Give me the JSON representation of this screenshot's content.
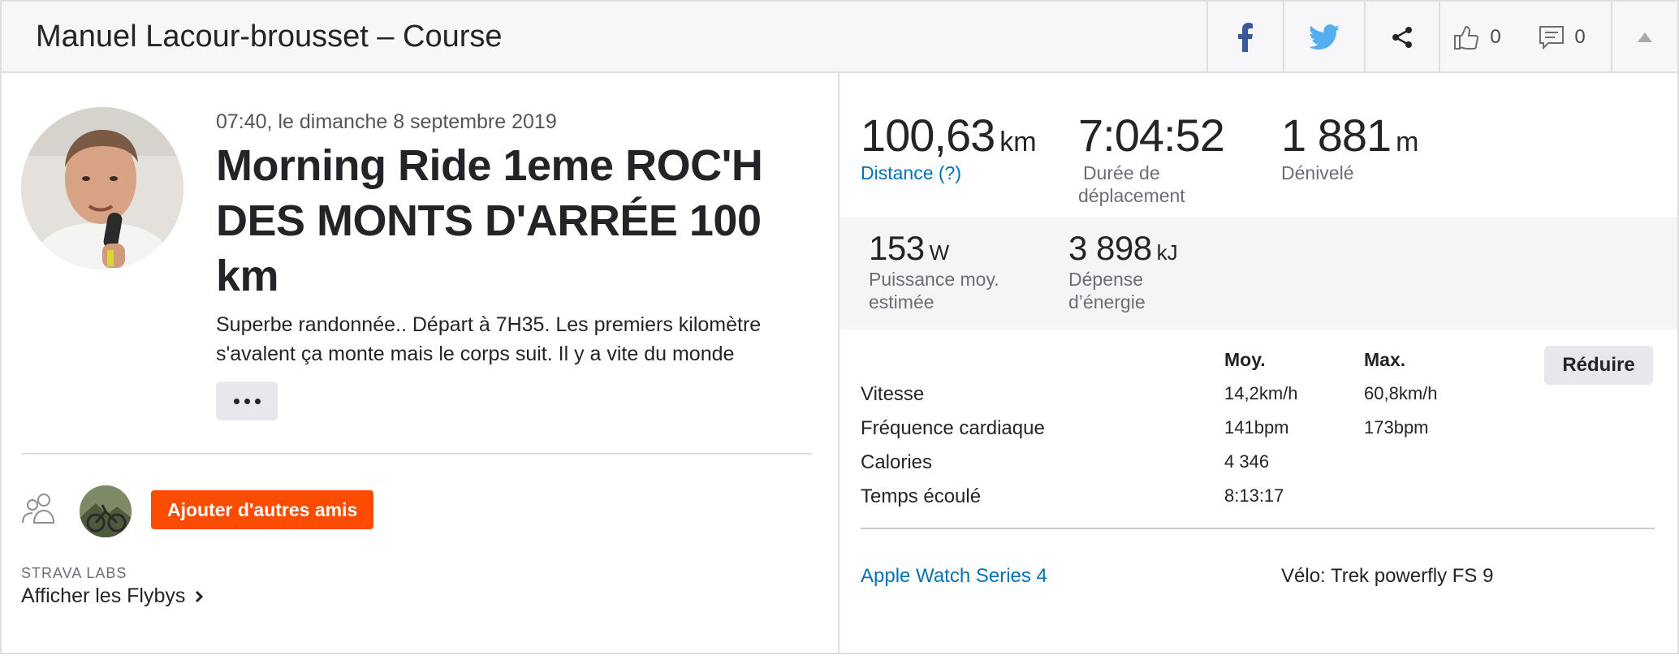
{
  "header": {
    "title": "Manuel Lacour-brousset – Course",
    "kudos_count": "0",
    "comments_count": "0"
  },
  "activity": {
    "date": "07:40, le dimanche 8 septembre 2019",
    "title": "Morning Ride 1eme ROC'H DES MONTS D'ARRÉE 100 km",
    "description_line1": "Superbe randonnée.. Départ à 7H35. Les premiers kilomètre",
    "description_line2": "s'avalent ça monte mais le corps suit. Il y a vite du monde"
  },
  "social": {
    "add_friends_label": "Ajouter d'autres amis",
    "labs_label": "STRAVA LABS",
    "flybys_label": "Afficher les Flybys"
  },
  "stats": {
    "distance": {
      "value": "100,63",
      "unit": "km",
      "label": "Distance (?)"
    },
    "moving_time": {
      "value": "7:04:52",
      "label_line1": "Durée de",
      "label_line2": "déplacement"
    },
    "elevation": {
      "value": "1 881",
      "unit": "m",
      "label": "Dénivelé"
    },
    "power": {
      "value": "153",
      "unit": "W",
      "label_line1": "Puissance moy.",
      "label_line2": "estimée"
    },
    "energy": {
      "value": "3 898",
      "unit": "kJ",
      "label_line1": "Dépense",
      "label_line2": "d’énergie"
    }
  },
  "details": {
    "avg_header": "Moy.",
    "max_header": "Max.",
    "collapse_label": "Réduire",
    "rows": [
      {
        "name": "Vitesse",
        "avg": "14,2km/h",
        "max": "60,8km/h"
      },
      {
        "name": "Fréquence cardiaque",
        "avg": "141bpm",
        "max": "173bpm"
      },
      {
        "name": "Calories",
        "avg": "4 346",
        "max": ""
      },
      {
        "name": "Temps écoulé",
        "avg": "8:13:17",
        "max": ""
      }
    ],
    "device": "Apple Watch Series 4",
    "bike": "Vélo: Trek powerfly FS 9"
  },
  "colors": {
    "accent": "#fc4c02",
    "link": "#0073b5",
    "facebook": "#3b5998",
    "twitter": "#55acee"
  },
  "icons": [
    "facebook-icon",
    "twitter-icon",
    "share-icon",
    "thumbs-up-icon",
    "comment-icon",
    "caret-up-icon",
    "group-icon",
    "chevron-right-icon"
  ]
}
